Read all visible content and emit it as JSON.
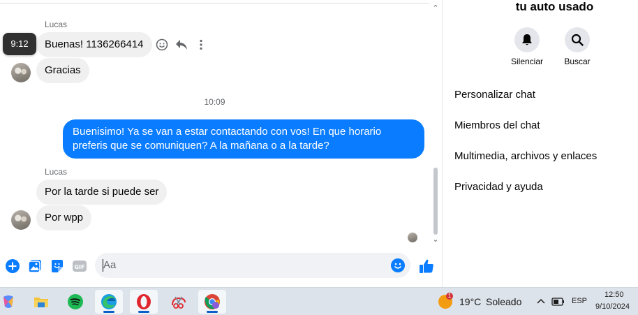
{
  "chat": {
    "sender_top": "Lucas",
    "tooltip_time": "9:12",
    "msg1": "Buenas! 1136266414",
    "msg2": "Gracias",
    "time_separator": "10:09",
    "outgoing": "Buenisimo! Ya se van a estar contactando con vos! En que horario preferis que se comuniquen? A la mañana o a la tarde?",
    "sender_bottom": "Lucas",
    "msg3": "Por la tarde si puede ser",
    "msg4": "Por wpp"
  },
  "composer": {
    "placeholder": "Aa",
    "gif_label": "GIF"
  },
  "side": {
    "title": "tu auto usado",
    "mute_label": "Silenciar",
    "search_label": "Buscar",
    "items": [
      {
        "label": "Personalizar chat"
      },
      {
        "label": "Miembros del chat"
      },
      {
        "label": "Multimedia, archivos y enlaces"
      },
      {
        "label": "Privacidad y ayuda"
      }
    ]
  },
  "taskbar": {
    "weather_temp": "19°C",
    "weather_desc": "Soleado",
    "weather_badge": "1",
    "lang": "ESP",
    "time": "12:50",
    "date": "9/10/2024"
  },
  "colors": {
    "accent": "#0a7cff",
    "incoming_bubble": "#f0f0f0",
    "taskbar": "#dde3ea"
  }
}
